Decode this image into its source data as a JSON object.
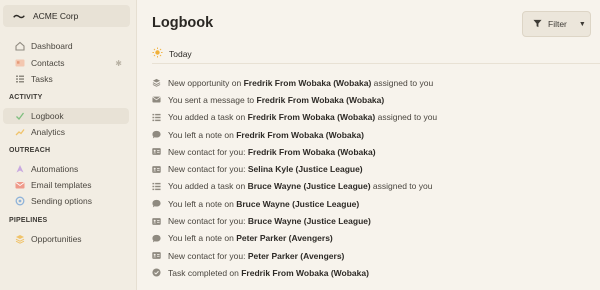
{
  "workspace": {
    "logo": "〜",
    "name": "ACME Corp"
  },
  "nav_top": [
    {
      "label": "Dashboard",
      "icon": "dashboard-icon"
    },
    {
      "label": "Contacts",
      "icon": "contacts-icon",
      "badge": "✱"
    },
    {
      "label": "Tasks",
      "icon": "tasks-icon"
    }
  ],
  "sections": {
    "activity": "ACTIVITY",
    "outreach": "OUTREACH",
    "pipelines": "PIPELINES"
  },
  "nav_activity": [
    {
      "label": "Logbook",
      "icon": "logbook-icon",
      "active": true
    },
    {
      "label": "Analytics",
      "icon": "analytics-icon"
    }
  ],
  "nav_outreach": [
    {
      "label": "Automations",
      "icon": "automations-icon"
    },
    {
      "label": "Email templates",
      "icon": "email-templates-icon"
    },
    {
      "label": "Sending options",
      "icon": "sending-options-icon"
    }
  ],
  "nav_pipelines": [
    {
      "label": "Opportunities",
      "icon": "opportunities-icon"
    }
  ],
  "main": {
    "title": "Logbook",
    "filter_label": "Filter",
    "today_label": "Today"
  },
  "feed": [
    {
      "icon": "stack-icon",
      "pre": "New opportunity on ",
      "bold": "Fredrik From Wobaka (Wobaka)",
      "post": " assigned to you"
    },
    {
      "icon": "mail-icon",
      "pre": "You sent a message to ",
      "bold": "Fredrik From Wobaka (Wobaka)",
      "post": ""
    },
    {
      "icon": "task-icon",
      "pre": "You added a task on ",
      "bold": "Fredrik From Wobaka (Wobaka)",
      "post": " assigned to you"
    },
    {
      "icon": "note-icon",
      "pre": "You left a note on ",
      "bold": "Fredrik From Wobaka (Wobaka)",
      "post": ""
    },
    {
      "icon": "contact-card-icon",
      "pre": "New contact for you: ",
      "bold": "Fredrik From Wobaka (Wobaka)",
      "post": ""
    },
    {
      "icon": "contact-card-icon",
      "pre": "New contact for you: ",
      "bold": "Selina Kyle (Justice League)",
      "post": ""
    },
    {
      "icon": "task-icon",
      "pre": "You added a task on ",
      "bold": "Bruce Wayne (Justice League)",
      "post": " assigned to you"
    },
    {
      "icon": "note-icon",
      "pre": "You left a note on ",
      "bold": "Bruce Wayne (Justice League)",
      "post": ""
    },
    {
      "icon": "contact-card-icon",
      "pre": "New contact for you: ",
      "bold": "Bruce Wayne (Justice League)",
      "post": ""
    },
    {
      "icon": "note-icon",
      "pre": "You left a note on ",
      "bold": "Peter Parker (Avengers)",
      "post": ""
    },
    {
      "icon": "contact-card-icon",
      "pre": "New contact for you: ",
      "bold": "Peter Parker (Avengers)",
      "post": ""
    },
    {
      "icon": "check-circle-icon",
      "pre": "Task completed on ",
      "bold": "Fredrik From Wobaka (Wobaka)",
      "post": ""
    }
  ],
  "colors": {
    "sidebar_bg": "#f2ede3",
    "main_bg": "#f7f3ec",
    "active_bg": "#e8e2d6",
    "icon_gray": "#8f8a80",
    "sun": "#f0b03a"
  }
}
